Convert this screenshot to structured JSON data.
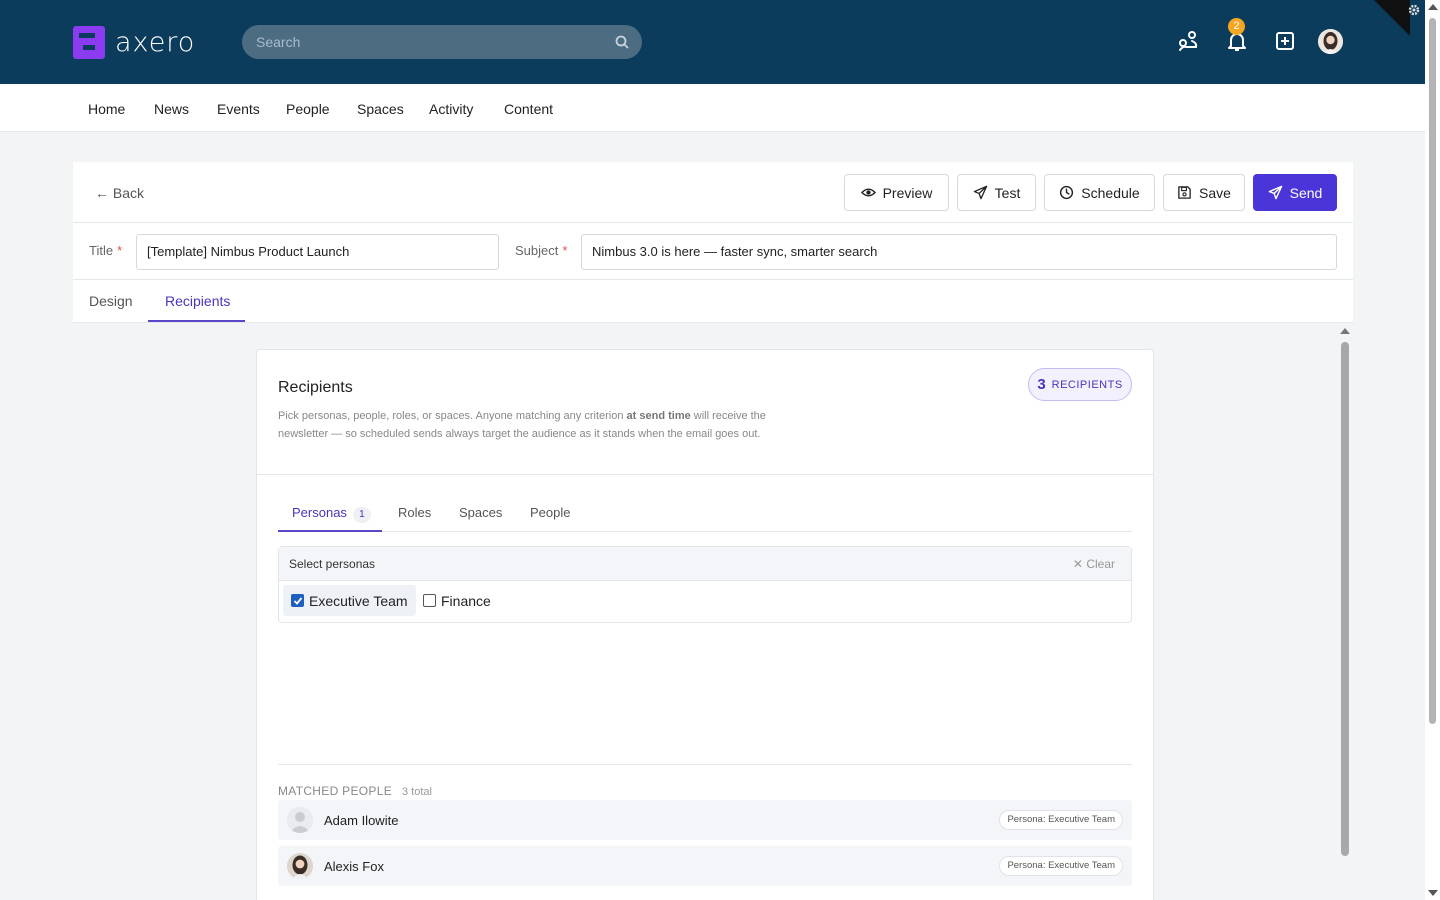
{
  "header": {
    "logo_text": "axero",
    "search_placeholder": "Search",
    "notification_count": "2"
  },
  "nav": {
    "items": [
      "Home",
      "News",
      "Events",
      "People",
      "Spaces",
      "Activity",
      "Content"
    ]
  },
  "toolbar": {
    "back_label": "← Back",
    "preview_label": "Preview",
    "test_label": "Test",
    "schedule_label": "Schedule",
    "save_label": "Save",
    "send_label": "Send"
  },
  "fields": {
    "title_label": "Title",
    "title_value": "[Template] Nimbus Product Launch",
    "subject_label": "Subject",
    "subject_value": "Nimbus 3.0 is here — faster sync, smarter search",
    "required_mark": "*"
  },
  "editor_tabs": [
    "Design",
    "Recipients"
  ],
  "recipients": {
    "title": "Recipients",
    "desc_part1": "Pick personas, people, roles, or spaces. Anyone matching any criterion ",
    "desc_bold": "at send time",
    "desc_part2": " will receive the newsletter — so scheduled sends always target the audience as it stands when the email goes out.",
    "count": "3",
    "count_label": "RECIPIENTS",
    "tabs": [
      {
        "label": "Personas",
        "count": "1"
      },
      {
        "label": "Roles"
      },
      {
        "label": "Spaces"
      },
      {
        "label": "People"
      }
    ],
    "select_title": "Select personas",
    "clear_label": "Clear",
    "personas": [
      {
        "label": "Executive Team",
        "checked": true
      },
      {
        "label": "Finance",
        "checked": false
      }
    ],
    "matched_title": "MATCHED PEOPLE",
    "matched_count": "3 total",
    "people": [
      {
        "name": "Adam Ilowite",
        "tag": "Persona: Executive Team"
      },
      {
        "name": "Alexis Fox",
        "tag": "Persona: Executive Team"
      }
    ]
  },
  "colors": {
    "header_bg": "#0c3c5c",
    "accent": "#4a36d8",
    "logo": "#8b3cf0",
    "badge": "#f5a623"
  }
}
